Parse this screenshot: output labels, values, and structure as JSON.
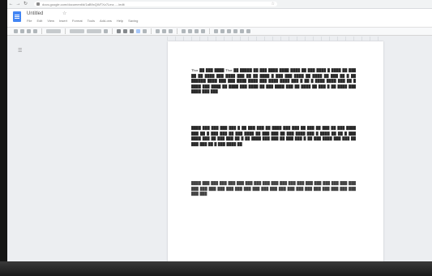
{
  "browser": {
    "url": "docs.google.com/document/d/1aB9xQWTXz7Lmz...../edit",
    "back": "←",
    "forward": "→",
    "reload": "↻"
  },
  "document": {
    "title": "Untitled",
    "menu": [
      "File",
      "Edit",
      "View",
      "Insert",
      "Format",
      "Tools",
      "Add-ons",
      "Help",
      "Saving"
    ]
  },
  "content": {
    "paragraphs": [
      "Thus ██ ███ ████ Thus ██ █████ ██ ███ ████ ████ ████ ██ ███ ████ █ ████ ██ ███ ██ ██ ████ ███ ████ ███ ██ ██ ████ █ ███ ███ ████ ██ ████ ██ ███ ██ █ ██ ██████ ████ ███ ███ ████ ████ ███ ████ ████ ███ █ ██ █ ████ ████ ███ ██ █ ████ ███ ████ ██ ████ ███ ████ ██ ███ ████ ███ ██ ████ ██ ███ █ ██ ████ ███ ████ ███ ███",
      "████ ███ ███ ███ ███ █ ██ ███ ███ ██ ████ ███ ███ ██ ███ ██ ███ ██ ███ ████ ███ ██ █ ███ ███ ██ ███ ████ ██ ███ ███ ██ ███ ████ ███ █ ████ ██ ██ █ ███ ████ ███ ██ ███ ███ ██ █ ██ ████ ███ ███ ██ ███ ███ █ ██ ███ ████ ███ ███ ██ ███ ███ ██ █ ███ ████ ██",
      "████ ███ ███ ███ ███ ███ ███ ███ ███ ███ ███ ███ ███ ███ ███ ███ ███ ███ ███ ███ ███ ███ ███ ███ ███ ███ ███ ███ ███ ███ ███ ███ ███ ███ ███ ███ ███ ███ ███ ███"
    ]
  }
}
